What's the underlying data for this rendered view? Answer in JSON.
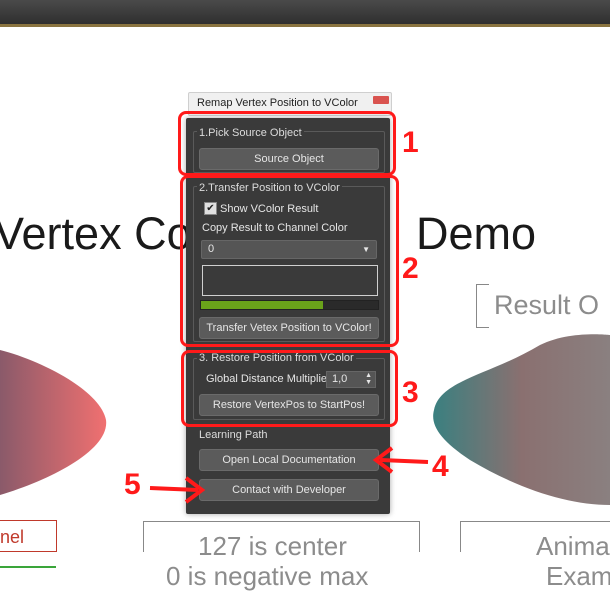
{
  "background": {
    "title_left": "Vertex Co",
    "title_right": "Demo",
    "result_label": "Result O",
    "center_text_1": "127 is center",
    "center_text_2": "0 is negative max",
    "right_text_1": "Anima",
    "right_text_2": "Exam",
    "left_red_text": "nel"
  },
  "window": {
    "title": "Remap Vertex Position to VColor"
  },
  "group1": {
    "label": "1.Pick Source Object",
    "button": "Source Object"
  },
  "group2": {
    "label": "2.Transfer Position to VColor",
    "show_vcolor_label": "Show VColor Result",
    "show_vcolor_checked": "✔",
    "copy_label": "Copy Result to Channel Color",
    "channel_value": "0",
    "progress": 0.69,
    "button": "Transfer Vetex Position to VColor!"
  },
  "group3": {
    "label": "3. Restore Position from VColor",
    "multiplier_label": "Global Distance Multiplier",
    "multiplier_value": "1,0",
    "button": "Restore VertexPos to StartPos!"
  },
  "group4": {
    "label": "Learning Path",
    "doc_button": "Open Local Documentation",
    "contact_button": "Contact with Developer"
  },
  "callouts": [
    "1",
    "2",
    "3",
    "4",
    "5"
  ],
  "colors": {
    "callout": "#ff1a1a",
    "panel": "#3a3a3a",
    "progress": "#6aa21a"
  }
}
